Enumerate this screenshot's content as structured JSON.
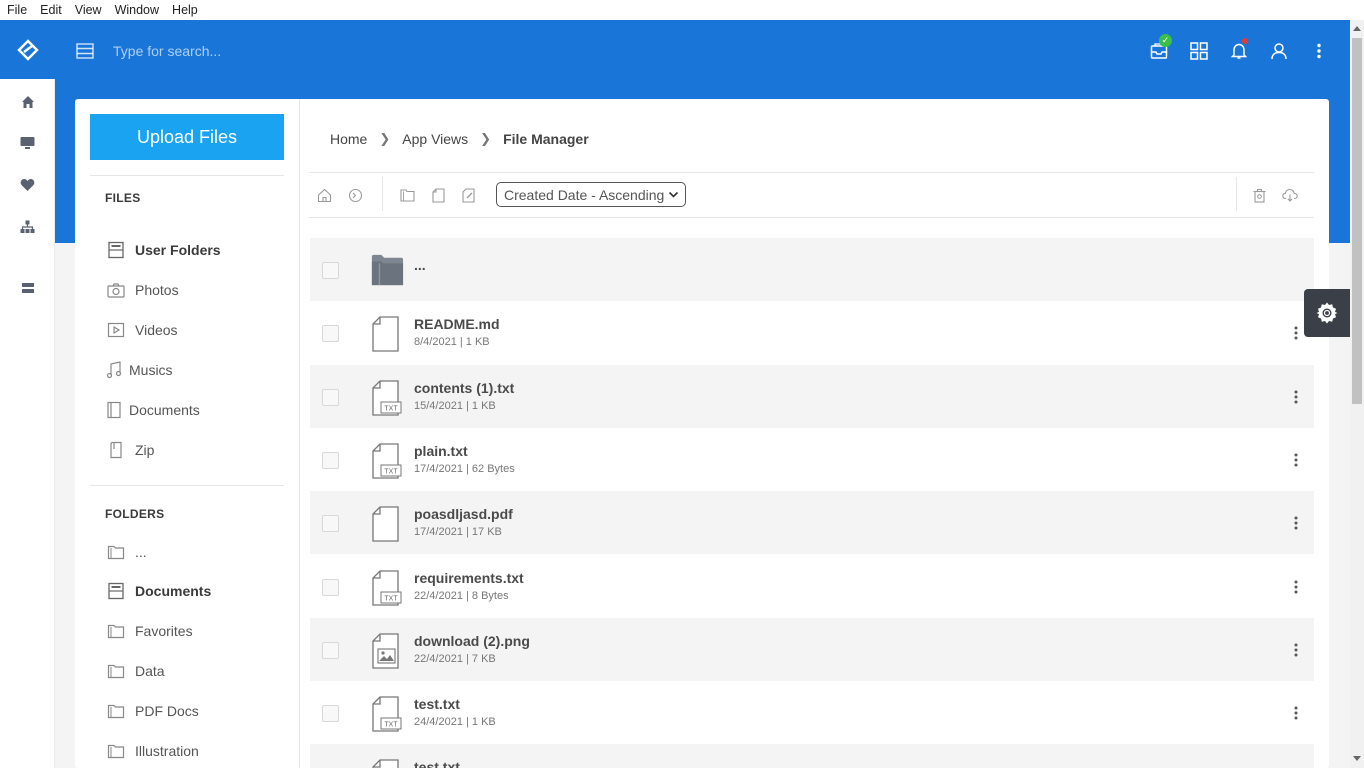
{
  "menubar": [
    "File",
    "Edit",
    "View",
    "Window",
    "Help"
  ],
  "header": {
    "search_placeholder": "Type for search..."
  },
  "sidebar": {
    "upload_label": "Upload Files",
    "files_title": "FILES",
    "files": [
      {
        "label": "User Folders",
        "icon": "user-folder-icon",
        "bold": true
      },
      {
        "label": "Photos",
        "icon": "camera-icon"
      },
      {
        "label": "Videos",
        "icon": "video-icon"
      },
      {
        "label": "Musics",
        "icon": "music-icon"
      },
      {
        "label": "Documents",
        "icon": "document-icon"
      },
      {
        "label": "Zip",
        "icon": "zip-icon"
      }
    ],
    "folders_title": "FOLDERS",
    "folders": [
      {
        "label": "...",
        "icon": "folder-icon"
      },
      {
        "label": "Documents",
        "icon": "user-folder-icon",
        "bold": true
      },
      {
        "label": "Favorites",
        "icon": "folder-icon"
      },
      {
        "label": "Data",
        "icon": "folder-icon"
      },
      {
        "label": "PDF Docs",
        "icon": "folder-icon"
      },
      {
        "label": "Illustration",
        "icon": "folder-icon"
      }
    ]
  },
  "breadcrumb": [
    "Home",
    "App Views",
    "File Manager"
  ],
  "toolbar": {
    "sort_value": "Created Date - Ascending"
  },
  "files": [
    {
      "name": "...",
      "meta": "",
      "type": "folder"
    },
    {
      "name": "README.md",
      "meta": "8/4/2021 | 1 KB",
      "type": "file"
    },
    {
      "name": "contents (1).txt",
      "meta": "15/4/2021 | 1 KB",
      "type": "txt"
    },
    {
      "name": "plain.txt",
      "meta": "17/4/2021 | 62 Bytes",
      "type": "txt"
    },
    {
      "name": "poasdljasd.pdf",
      "meta": "17/4/2021 | 17 KB",
      "type": "file"
    },
    {
      "name": "requirements.txt",
      "meta": "22/4/2021 | 8 Bytes",
      "type": "txt"
    },
    {
      "name": "download (2).png",
      "meta": "22/4/2021 | 7 KB",
      "type": "image"
    },
    {
      "name": "test.txt",
      "meta": "24/4/2021 | 1 KB",
      "type": "txt"
    },
    {
      "name": "test.txt",
      "meta": "",
      "type": "txt"
    }
  ],
  "colors": {
    "header_blue": "#1976d8",
    "upload_blue": "#1aa3f0",
    "badge_green": "#3bbf48",
    "notif_red": "#e53935"
  }
}
